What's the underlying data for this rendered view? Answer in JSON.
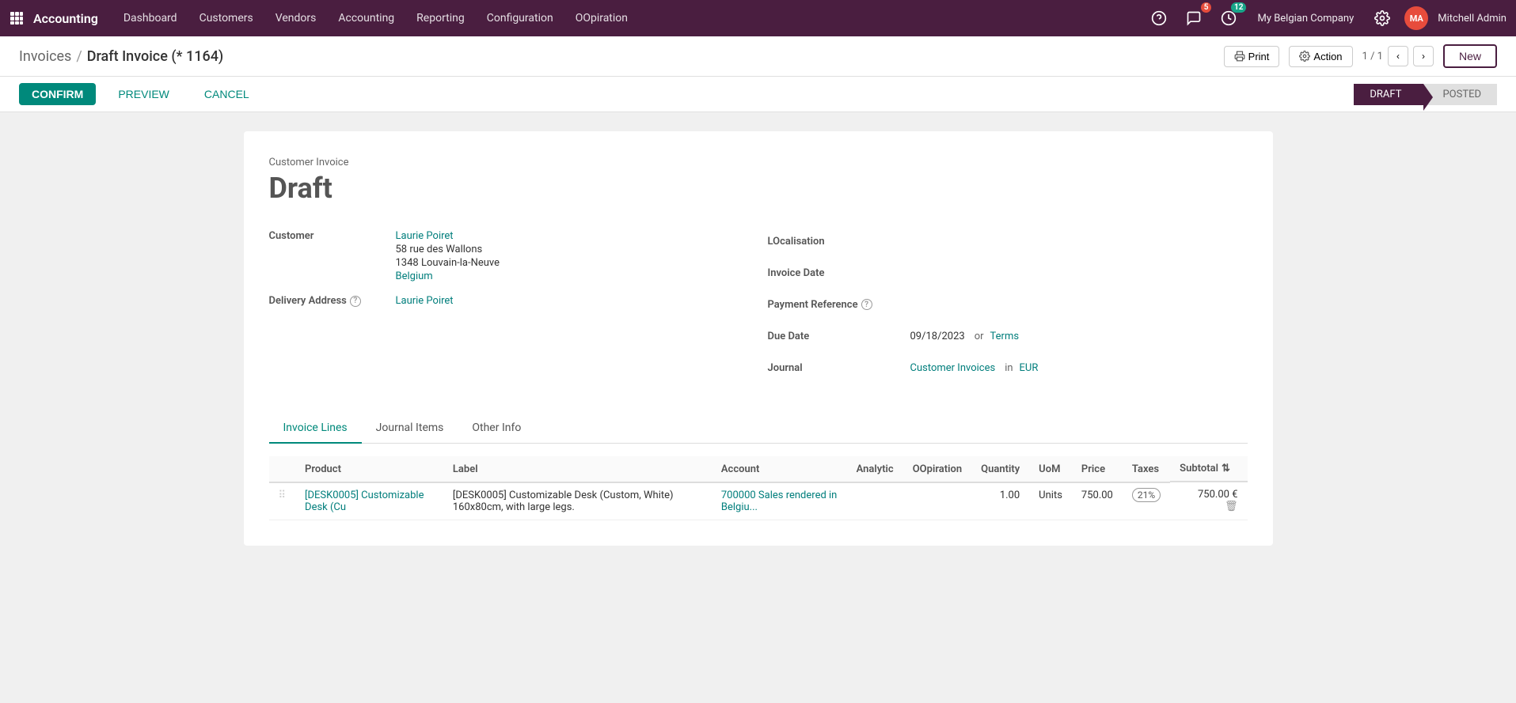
{
  "app": {
    "name": "Accounting",
    "nav_items": [
      "Dashboard",
      "Customers",
      "Vendors",
      "Accounting",
      "Reporting",
      "Configuration",
      "OOpiration"
    ],
    "notifications_count": "5",
    "activity_count": "12",
    "company": "My Belgian Company",
    "user": "Mitchell Admin"
  },
  "breadcrumb": {
    "parent": "Invoices",
    "separator": "/",
    "current": "Draft Invoice (* 1164)"
  },
  "toolbar": {
    "print_label": "Print",
    "action_label": "Action",
    "pagination": "1 / 1",
    "new_label": "New"
  },
  "actions": {
    "confirm_label": "CONFIRM",
    "preview_label": "PREVIEW",
    "cancel_label": "CANCEL"
  },
  "status": {
    "draft_label": "DRAFT",
    "posted_label": "POSTED"
  },
  "invoice": {
    "type": "Customer Invoice",
    "status_title": "Draft",
    "customer_label": "Customer",
    "customer_name": "Laurie Poiret",
    "customer_address1": "58 rue des Wallons",
    "customer_address2": "1348 Louvain-la-Neuve",
    "customer_country": "Belgium",
    "delivery_label": "Delivery Address",
    "delivery_help": "?",
    "delivery_value": "Laurie Poiret",
    "localisation_label": "LOcalisation",
    "invoice_date_label": "Invoice Date",
    "payment_ref_label": "Payment Reference",
    "payment_ref_help": "?",
    "due_date_label": "Due Date",
    "due_date_value": "09/18/2023",
    "or_label": "or",
    "terms_label": "Terms",
    "journal_label": "Journal",
    "journal_value": "Customer Invoices",
    "in_label": "in",
    "currency": "EUR"
  },
  "tabs": {
    "invoice_lines": "Invoice Lines",
    "journal_items": "Journal Items",
    "other_info": "Other Info"
  },
  "table": {
    "headers": {
      "product": "Product",
      "label": "Label",
      "account": "Account",
      "analytic": "Analytic",
      "oopiration": "OOpiration",
      "quantity": "Quantity",
      "uom": "UoM",
      "price": "Price",
      "taxes": "Taxes",
      "subtotal": "Subtotal"
    },
    "rows": [
      {
        "product": "[DESK0005] Customizable Desk (Cu",
        "label": "[DESK0005] Customizable Desk (Custom, White) 160x80cm, with large legs.",
        "account": "700000 Sales rendered in Belgiu...",
        "analytic": "",
        "oopiration": "",
        "quantity": "1.00",
        "uom": "Units",
        "price": "750.00",
        "taxes": "21%",
        "subtotal": "750.00 €"
      }
    ]
  }
}
